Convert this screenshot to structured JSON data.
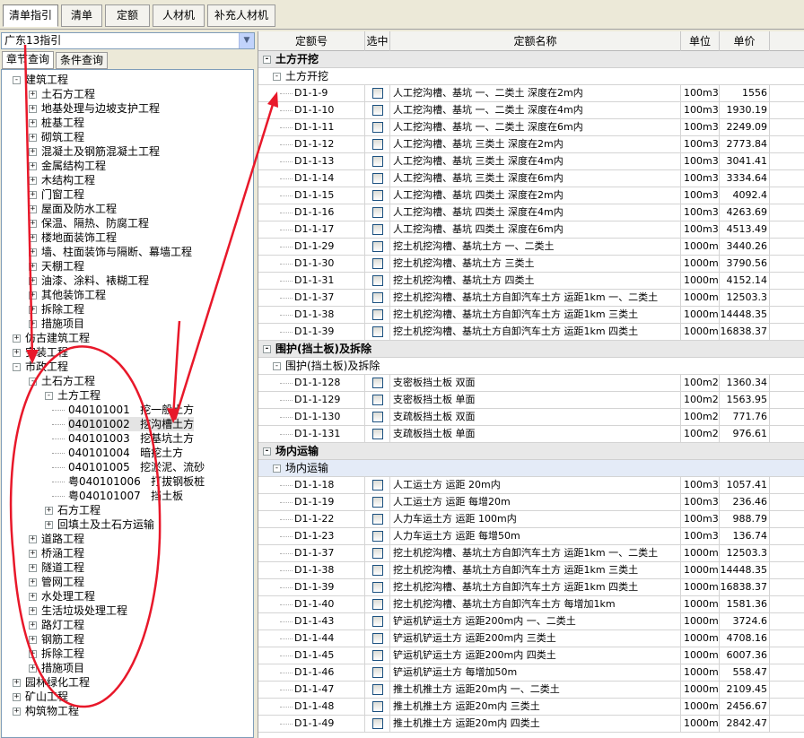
{
  "top_tabs": [
    "清单指引",
    "清单",
    "定额",
    "人材机",
    "补充人材机"
  ],
  "left": {
    "combo_value": "广东13指引",
    "subtabs": [
      "章节查询",
      "条件查询"
    ],
    "tree": [
      {
        "label": "建筑工程",
        "level": 0,
        "toggle": "-"
      },
      {
        "label": "土石方工程",
        "level": 1,
        "toggle": "+"
      },
      {
        "label": "地基处理与边坡支护工程",
        "level": 1,
        "toggle": "+"
      },
      {
        "label": "桩基工程",
        "level": 1,
        "toggle": "+"
      },
      {
        "label": "砌筑工程",
        "level": 1,
        "toggle": "+"
      },
      {
        "label": "混凝土及钢筋混凝土工程",
        "level": 1,
        "toggle": "+"
      },
      {
        "label": "金属结构工程",
        "level": 1,
        "toggle": "+"
      },
      {
        "label": "木结构工程",
        "level": 1,
        "toggle": "+"
      },
      {
        "label": "门窗工程",
        "level": 1,
        "toggle": "+"
      },
      {
        "label": "屋面及防水工程",
        "level": 1,
        "toggle": "+"
      },
      {
        "label": "保温、隔热、防腐工程",
        "level": 1,
        "toggle": "+"
      },
      {
        "label": "楼地面装饰工程",
        "level": 1,
        "toggle": "+"
      },
      {
        "label": "墙、柱面装饰与隔断、幕墙工程",
        "level": 1,
        "toggle": "+"
      },
      {
        "label": "天棚工程",
        "level": 1,
        "toggle": "+"
      },
      {
        "label": "油漆、涂料、裱糊工程",
        "level": 1,
        "toggle": "+"
      },
      {
        "label": "其他装饰工程",
        "level": 1,
        "toggle": "+"
      },
      {
        "label": "拆除工程",
        "level": 1,
        "toggle": "+"
      },
      {
        "label": "措施项目",
        "level": 1,
        "toggle": "+"
      },
      {
        "label": "仿古建筑工程",
        "level": 0,
        "toggle": "+"
      },
      {
        "label": "安装工程",
        "level": 0,
        "toggle": "+"
      },
      {
        "label": "市政工程",
        "level": 0,
        "toggle": "-"
      },
      {
        "label": "土石方工程",
        "level": 1,
        "toggle": "-"
      },
      {
        "label": "土方工程",
        "level": 2,
        "toggle": "-"
      },
      {
        "label": "040101001   挖一般土方",
        "level": 3,
        "toggle": ""
      },
      {
        "label": "040101002   挖沟槽土方",
        "level": 3,
        "toggle": "",
        "selected": true
      },
      {
        "label": "040101003   挖基坑土方",
        "level": 3,
        "toggle": ""
      },
      {
        "label": "040101004   暗挖土方",
        "level": 3,
        "toggle": ""
      },
      {
        "label": "040101005   挖淤泥、流砂",
        "level": 3,
        "toggle": ""
      },
      {
        "label": "粤040101006   打拔钢板桩",
        "level": 3,
        "toggle": ""
      },
      {
        "label": "粤040101007   挡土板",
        "level": 3,
        "toggle": ""
      },
      {
        "label": "石方工程",
        "level": 2,
        "toggle": "+"
      },
      {
        "label": "回填土及土石方运输",
        "level": 2,
        "toggle": "+"
      },
      {
        "label": "道路工程",
        "level": 1,
        "toggle": "+"
      },
      {
        "label": "桥涵工程",
        "level": 1,
        "toggle": "+"
      },
      {
        "label": "隧道工程",
        "level": 1,
        "toggle": "+"
      },
      {
        "label": "管网工程",
        "level": 1,
        "toggle": "+"
      },
      {
        "label": "水处理工程",
        "level": 1,
        "toggle": "+"
      },
      {
        "label": "生活垃圾处理工程",
        "level": 1,
        "toggle": "+"
      },
      {
        "label": "路灯工程",
        "level": 1,
        "toggle": "+"
      },
      {
        "label": "钢筋工程",
        "level": 1,
        "toggle": "+"
      },
      {
        "label": "拆除工程",
        "level": 1,
        "toggle": "+"
      },
      {
        "label": "措施项目",
        "level": 1,
        "toggle": "+"
      },
      {
        "label": "园林绿化工程",
        "level": 0,
        "toggle": "+"
      },
      {
        "label": "矿山工程",
        "level": 0,
        "toggle": "+"
      },
      {
        "label": "构筑物工程",
        "level": 0,
        "toggle": "+"
      }
    ]
  },
  "grid": {
    "headers": [
      "定额号",
      "选中",
      "定额名称",
      "单位",
      "单价"
    ],
    "rows": [
      {
        "t": "grp",
        "label": "土方开挖"
      },
      {
        "t": "sub",
        "label": "土方开挖"
      },
      {
        "code": "D1-1-9",
        "name": "人工挖沟槽、基坑 一、二类土 深度在2m内",
        "unit": "100m3",
        "price": "1556"
      },
      {
        "code": "D1-1-10",
        "name": "人工挖沟槽、基坑 一、二类土 深度在4m内",
        "unit": "100m3",
        "price": "1930.19"
      },
      {
        "code": "D1-1-11",
        "name": "人工挖沟槽、基坑 一、二类土 深度在6m内",
        "unit": "100m3",
        "price": "2249.09"
      },
      {
        "code": "D1-1-12",
        "name": "人工挖沟槽、基坑 三类土 深度在2m内",
        "unit": "100m3",
        "price": "2773.84"
      },
      {
        "code": "D1-1-13",
        "name": "人工挖沟槽、基坑 三类土 深度在4m内",
        "unit": "100m3",
        "price": "3041.41"
      },
      {
        "code": "D1-1-14",
        "name": "人工挖沟槽、基坑 三类土 深度在6m内",
        "unit": "100m3",
        "price": "3334.64"
      },
      {
        "code": "D1-1-15",
        "name": "人工挖沟槽、基坑 四类土 深度在2m内",
        "unit": "100m3",
        "price": "4092.4"
      },
      {
        "code": "D1-1-16",
        "name": "人工挖沟槽、基坑 四类土 深度在4m内",
        "unit": "100m3",
        "price": "4263.69"
      },
      {
        "code": "D1-1-17",
        "name": "人工挖沟槽、基坑 四类土 深度在6m内",
        "unit": "100m3",
        "price": "4513.49"
      },
      {
        "code": "D1-1-29",
        "name": "挖土机挖沟槽、基坑土方 一、二类土",
        "unit": "1000m3",
        "price": "3440.26"
      },
      {
        "code": "D1-1-30",
        "name": "挖土机挖沟槽、基坑土方 三类土",
        "unit": "1000m3",
        "price": "3790.56"
      },
      {
        "code": "D1-1-31",
        "name": "挖土机挖沟槽、基坑土方 四类土",
        "unit": "1000m3",
        "price": "4152.14"
      },
      {
        "code": "D1-1-37",
        "name": "挖土机挖沟槽、基坑土方自卸汽车土方 运距1km 一、二类土",
        "unit": "1000m3",
        "price": "12503.3"
      },
      {
        "code": "D1-1-38",
        "name": "挖土机挖沟槽、基坑土方自卸汽车土方 运距1km 三类土",
        "unit": "1000m3",
        "price": "14448.35"
      },
      {
        "code": "D1-1-39",
        "name": "挖土机挖沟槽、基坑土方自卸汽车土方 运距1km 四类土",
        "unit": "1000m3",
        "price": "16838.37"
      },
      {
        "t": "grp",
        "label": "围护(挡土板)及拆除"
      },
      {
        "t": "sub",
        "label": "围护(挡土板)及拆除"
      },
      {
        "code": "D1-1-128",
        "name": "支密板挡土板 双面",
        "unit": "100m2",
        "price": "1360.34"
      },
      {
        "code": "D1-1-129",
        "name": "支密板挡土板 单面",
        "unit": "100m2",
        "price": "1563.95"
      },
      {
        "code": "D1-1-130",
        "name": "支疏板挡土板 双面",
        "unit": "100m2",
        "price": "771.76"
      },
      {
        "code": "D1-1-131",
        "name": "支疏板挡土板 单面",
        "unit": "100m2",
        "price": "976.61"
      },
      {
        "t": "grp",
        "label": "场内运输"
      },
      {
        "t": "sub",
        "label": "场内运输",
        "blue": true
      },
      {
        "code": "D1-1-18",
        "name": "人工运土方 运距 20m内",
        "unit": "100m3",
        "price": "1057.41"
      },
      {
        "code": "D1-1-19",
        "name": "人工运土方 运距 每增20m",
        "unit": "100m3",
        "price": "236.46"
      },
      {
        "code": "D1-1-22",
        "name": "人力车运土方 运距 100m内",
        "unit": "100m3",
        "price": "988.79"
      },
      {
        "code": "D1-1-23",
        "name": "人力车运土方 运距 每增50m",
        "unit": "100m3",
        "price": "136.74"
      },
      {
        "code": "D1-1-37",
        "name": "挖土机挖沟槽、基坑土方自卸汽车土方 运距1km 一、二类土",
        "unit": "1000m3",
        "price": "12503.3"
      },
      {
        "code": "D1-1-38",
        "name": "挖土机挖沟槽、基坑土方自卸汽车土方 运距1km 三类土",
        "unit": "1000m3",
        "price": "14448.35"
      },
      {
        "code": "D1-1-39",
        "name": "挖土机挖沟槽、基坑土方自卸汽车土方 运距1km 四类土",
        "unit": "1000m3",
        "price": "16838.37"
      },
      {
        "code": "D1-1-40",
        "name": "挖土机挖沟槽、基坑土方自卸汽车土方 每增加1km",
        "unit": "1000m3",
        "price": "1581.36"
      },
      {
        "code": "D1-1-43",
        "name": "铲运机铲运土方 运距200m内 一、二类土",
        "unit": "1000m3",
        "price": "3724.6"
      },
      {
        "code": "D1-1-44",
        "name": "铲运机铲运土方 运距200m内 三类土",
        "unit": "1000m3",
        "price": "4708.16"
      },
      {
        "code": "D1-1-45",
        "name": "铲运机铲运土方 运距200m内 四类土",
        "unit": "1000m3",
        "price": "6007.36"
      },
      {
        "code": "D1-1-46",
        "name": "铲运机铲运土方 每增加50m",
        "unit": "1000m3",
        "price": "558.47"
      },
      {
        "code": "D1-1-47",
        "name": "推土机推土方 运距20m内 一、二类土",
        "unit": "1000m3",
        "price": "2109.45"
      },
      {
        "code": "D1-1-48",
        "name": "推土机推土方 运距20m内 三类土",
        "unit": "1000m3",
        "price": "2456.67"
      },
      {
        "code": "D1-1-49",
        "name": "推土机推土方 运距20m内 四类土",
        "unit": "1000m3",
        "price": "2842.47"
      }
    ]
  },
  "colors": {
    "annotation": "#e8182a",
    "selection": "#e4e4e4"
  }
}
